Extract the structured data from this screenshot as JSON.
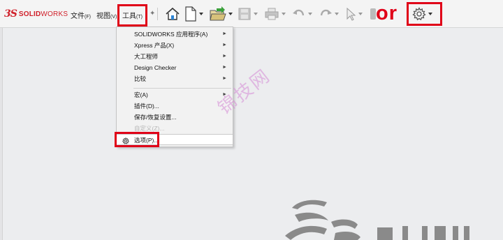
{
  "brand": {
    "mark": "3S",
    "name_bold": "SOLID",
    "name_regular": "WORKS"
  },
  "menubar": [
    {
      "label": "文件",
      "key": "(F)"
    },
    {
      "label": "视图",
      "key": "(V)"
    },
    {
      "label": "工具",
      "key": "(T)"
    }
  ],
  "toolbar": {
    "icons": [
      "home-icon",
      "new-document-icon",
      "open-folder-icon",
      "save-icon",
      "print-icon",
      "undo-icon",
      "redo-icon",
      "select-cursor-icon",
      "traffic-light-icon",
      "gear-icon"
    ]
  },
  "annotation": {
    "or_text": "or"
  },
  "tools_menu": {
    "items": [
      {
        "label": "SOLIDWORKS 应用程序(A)",
        "submenu": "►"
      },
      {
        "label": "Xpress 产品(X)",
        "submenu": "►"
      },
      {
        "label": "大工程师",
        "submenu": "►"
      },
      {
        "label": "Design Checker",
        "submenu": "►"
      },
      {
        "label": "比较",
        "submenu": "►"
      },
      {
        "label": "宏(A)",
        "submenu": "►"
      },
      {
        "label": "插件(D)...",
        "submenu": ""
      },
      {
        "label": "保存/恢复设置...",
        "submenu": ""
      },
      {
        "label": "自定义(Z)...",
        "submenu": ""
      },
      {
        "label": "选项(P)...",
        "submenu": ""
      }
    ]
  },
  "watermark": "锦技网",
  "colors": {
    "highlight": "#e00018",
    "brand": "#d0202a",
    "watermark": "#d68bd6"
  }
}
